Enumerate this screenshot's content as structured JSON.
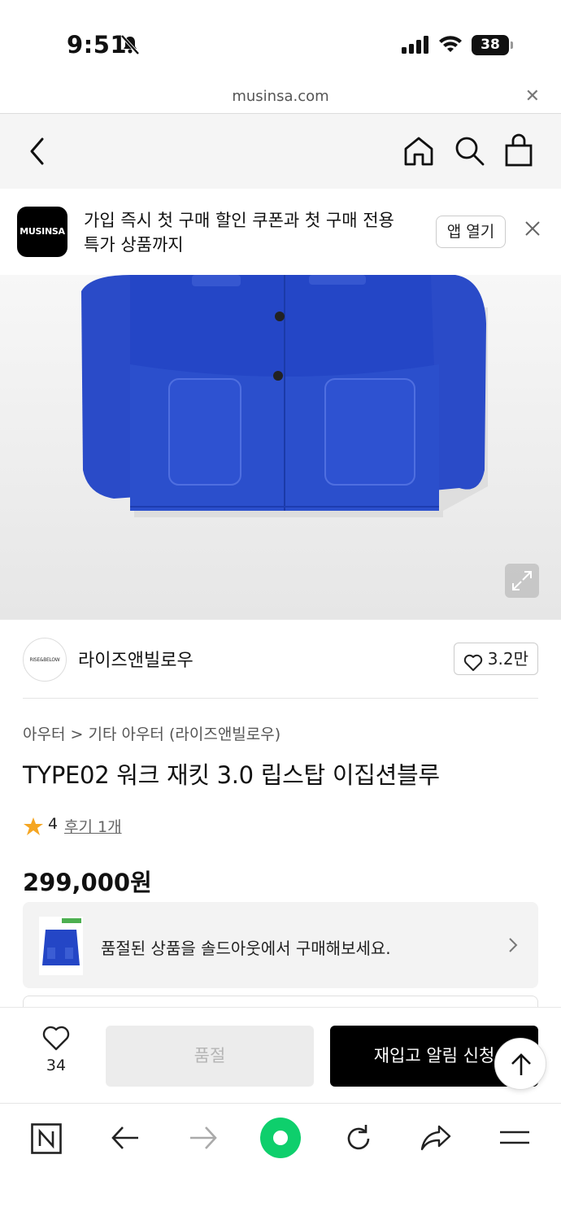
{
  "status_bar": {
    "time": "9:51",
    "battery": "38"
  },
  "browser": {
    "url": "musinsa.com"
  },
  "app_banner": {
    "logo_text": "MUSINSA",
    "message_line1": "가입 즉시 첫 구매 할인 쿠폰과 첫 구매 전용",
    "message_line2": "특가 상품까지",
    "open_label": "앱 열기"
  },
  "brand": {
    "logo_text": "RISE&BELOW",
    "name": "라이즈앤빌로우",
    "likes": "3.2만"
  },
  "product": {
    "breadcrumb_category": "아우터",
    "breadcrumb_separator": ">",
    "breadcrumb_sub": "기타 아우터",
    "breadcrumb_brand": "(라이즈앤빌로우)",
    "title": "TYPE02 워크 재킷 3.0 립스탑 이집션블루",
    "rating": "4",
    "review_link": "후기 1개",
    "price": "299,000원",
    "soldout_notice": "품절된 상품을 솔드아웃에서 구매해보세요."
  },
  "purchase_bar": {
    "wish_count": "34",
    "soldout_label": "품절",
    "restock_label": "재입고 알림 신청"
  },
  "colors": {
    "accent_green": "#0ecf6c",
    "jacket_blue": "#2546c8",
    "star": "#f5a623"
  },
  "icons": [
    "bell-off-icon",
    "signal-icon",
    "wifi-icon",
    "back-icon",
    "home-icon",
    "search-icon",
    "bag-icon",
    "close-icon",
    "expand-icon",
    "heart-icon",
    "star-icon",
    "chevron-right-icon",
    "arrow-up-icon",
    "n-icon",
    "arrow-left-icon",
    "arrow-right-icon",
    "reload-icon",
    "share-icon",
    "menu-icon"
  ]
}
